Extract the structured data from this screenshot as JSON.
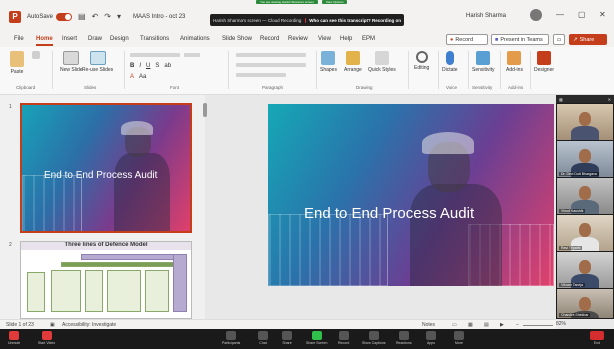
{
  "titlebar": {
    "logo": "P",
    "autosave": "AutoSave",
    "toggle_state": "On",
    "doc_name": "MAAS Intro - oct 23",
    "user": "Harish Sharma"
  },
  "zoom_banner": {
    "top_labels": [
      "You are viewing Harish Sharma's screen",
      "View Options"
    ],
    "sharing_text": "Harish Sharma's screen — Cloud Recording",
    "question": "Who can see this transcript? Recording on"
  },
  "tabs": [
    "File",
    "Home",
    "Insert",
    "Draw",
    "Design",
    "Transitions",
    "Animations",
    "Slide Show",
    "Record",
    "Review",
    "View",
    "Help",
    "EPM"
  ],
  "active_tab": "Home",
  "buttons": {
    "record": "Record",
    "present": "Present in Teams",
    "share": "Share"
  },
  "ribbon": {
    "clipboard": {
      "paste": "Paste",
      "label": "Clipboard"
    },
    "slides": {
      "new_slide": "New Slide",
      "reuse": "Re-use Slides",
      "label": "Slides"
    },
    "font_label": "Font",
    "paragraph_label": "Paragraph",
    "drawing": {
      "shapes": "Shapes",
      "arrange": "Arrange",
      "quick_styles": "Quick Styles",
      "label": "Drawing"
    },
    "editing": "Editing",
    "voice": {
      "dictate": "Dictate",
      "label": "Voice"
    },
    "sensitivity": {
      "btn": "Sensitivity",
      "label": "Sensitivity"
    },
    "addins": {
      "btn": "Add-ins",
      "label": "Add-ins"
    },
    "designer": "Designer",
    "font_buttons": [
      "B",
      "I",
      "U",
      "S",
      "ab",
      "A",
      "Aa"
    ]
  },
  "slides": [
    {
      "num": "1",
      "title": "End to End Process Audit"
    },
    {
      "num": "2",
      "title": "Three lines of Defence Model"
    }
  ],
  "main_slide": {
    "title": "End to End Process Audit"
  },
  "statusbar": {
    "slide_info": "Slide 1 of 23",
    "accessibility": "Accessibility: Investigate",
    "notes": "Notes",
    "zoom": "82%"
  },
  "participants": [
    {
      "name": ""
    },
    {
      "name": "Dr. Devi Dutt Bhargava"
    },
    {
      "name": "Vinod Kaushik"
    },
    {
      "name": "Ravi Tripathi"
    },
    {
      "name": "Vikram Taneja"
    },
    {
      "name": "Chandra Shekhar"
    }
  ],
  "zoom_toolbar": [
    "Unmute",
    "Start Video",
    "Participants",
    "Chat",
    "Share",
    "Share Screen",
    "Record",
    "Show Captions",
    "Reactions",
    "Apps",
    "More",
    "End"
  ],
  "colors": {
    "accent": "#c43e1c",
    "zoom_dark": "#1a1a1a",
    "zoom_green": "#2fbf4a"
  }
}
